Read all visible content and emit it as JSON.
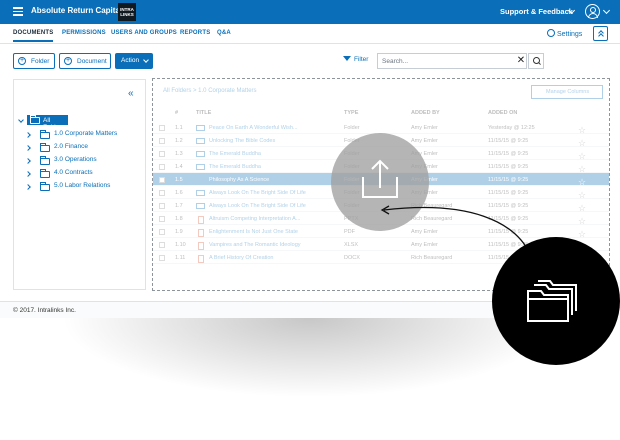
{
  "topbar": {
    "app_title": "Absolute Return Capital",
    "logo_line1": "INTRA",
    "logo_line2": "LINKS",
    "support_label": "Support & Feedback"
  },
  "nav": {
    "tabs": [
      {
        "label": "DOCUMENTS",
        "active": true
      },
      {
        "label": "PERMISSIONS",
        "active": false
      },
      {
        "label": "USERS AND GROUPS",
        "active": false
      },
      {
        "label": "REPORTS",
        "active": false
      },
      {
        "label": "Q&A",
        "active": false
      }
    ],
    "settings_label": "Settings"
  },
  "toolbar": {
    "folder_label": "Folder",
    "document_label": "Document",
    "action_label": "Action",
    "filter_label": "Filter",
    "search_placeholder": "Search..."
  },
  "tree": {
    "root": "All Folders",
    "items": [
      "1.0 Corporate Matters",
      "2.0 Finance",
      "3.0 Operations",
      "4.0 Contracts",
      "5.0 Labor Relations"
    ]
  },
  "main": {
    "breadcrumb": "All Folders > 1.0 Corporate Matters",
    "manage_columns_label": "Manage Columns",
    "headers": {
      "num": "#",
      "title": "TITLE",
      "type": "TYPE",
      "added_by": "ADDED BY",
      "added_on": "ADDED ON"
    },
    "rows": [
      {
        "num": "1.1",
        "title": "Peace On Earth A Wonderful Wish...",
        "type": "Folder",
        "kind": "folder",
        "added_by": "Amy Emler",
        "added_on": "Yesterday @ 12:25",
        "selected": false
      },
      {
        "num": "1.2",
        "title": "Unlocking The Bible Codes",
        "type": "Folder",
        "kind": "folder",
        "added_by": "Amy Emler",
        "added_on": "11/15/15 @ 9:25",
        "selected": false
      },
      {
        "num": "1.3",
        "title": "The Emerald Buddha",
        "type": "Folder",
        "kind": "folder",
        "added_by": "Amy Emler",
        "added_on": "11/15/15 @ 9:25",
        "selected": false
      },
      {
        "num": "1.4",
        "title": "The Emerald Buddha",
        "type": "Folder",
        "kind": "folder",
        "added_by": "Amy Emler",
        "added_on": "11/15/15 @ 9:25",
        "selected": false
      },
      {
        "num": "1.5",
        "title": "Philosophy As A Science",
        "type": "Folder",
        "kind": "folder",
        "added_by": "Amy Emler",
        "added_on": "11/15/15 @ 9:25",
        "selected": true
      },
      {
        "num": "1.6",
        "title": "Always Look On The Bright Side Of Life",
        "type": "Folder",
        "kind": "folder",
        "added_by": "Amy Emler",
        "added_on": "11/15/15 @ 9:25",
        "selected": false
      },
      {
        "num": "1.7",
        "title": "Always Look On The Bright Side Of Life",
        "type": "Folder",
        "kind": "folder",
        "added_by": "Rich Beauregard",
        "added_on": "11/15/15 @ 9:25",
        "selected": false
      },
      {
        "num": "1.8",
        "title": "Altruism Competing Interpretation A...",
        "type": "PPTX",
        "kind": "doc",
        "added_by": "Rich Beauregard",
        "added_on": "11/15/15 @ 9:25",
        "selected": false
      },
      {
        "num": "1.9",
        "title": "Enlightenment Is Not Just One State",
        "type": "PDF",
        "kind": "doc",
        "added_by": "Amy Emler",
        "added_on": "11/15/15 @ 9:25",
        "selected": false
      },
      {
        "num": "1.10",
        "title": "Vampires and The Romantic Ideology",
        "type": "XLSX",
        "kind": "doc",
        "added_by": "Amy Emler",
        "added_on": "11/15/15 @ 9:25",
        "selected": false
      },
      {
        "num": "1.11",
        "title": "A Brief History Of Creation",
        "type": "DOCX",
        "kind": "doc",
        "added_by": "Rich Beauregard",
        "added_on": "11/15/15 @ 9:25",
        "selected": false
      }
    ]
  },
  "footer": {
    "copyright": "© 2017. Intralinks Inc."
  },
  "colors": {
    "brand": "#0a6fb8",
    "overlay_gray": "#a0a0a0",
    "drop_circle": "#000000"
  },
  "icons": {
    "upload": "upload-icon",
    "drop_target": "folders-stack-icon"
  }
}
